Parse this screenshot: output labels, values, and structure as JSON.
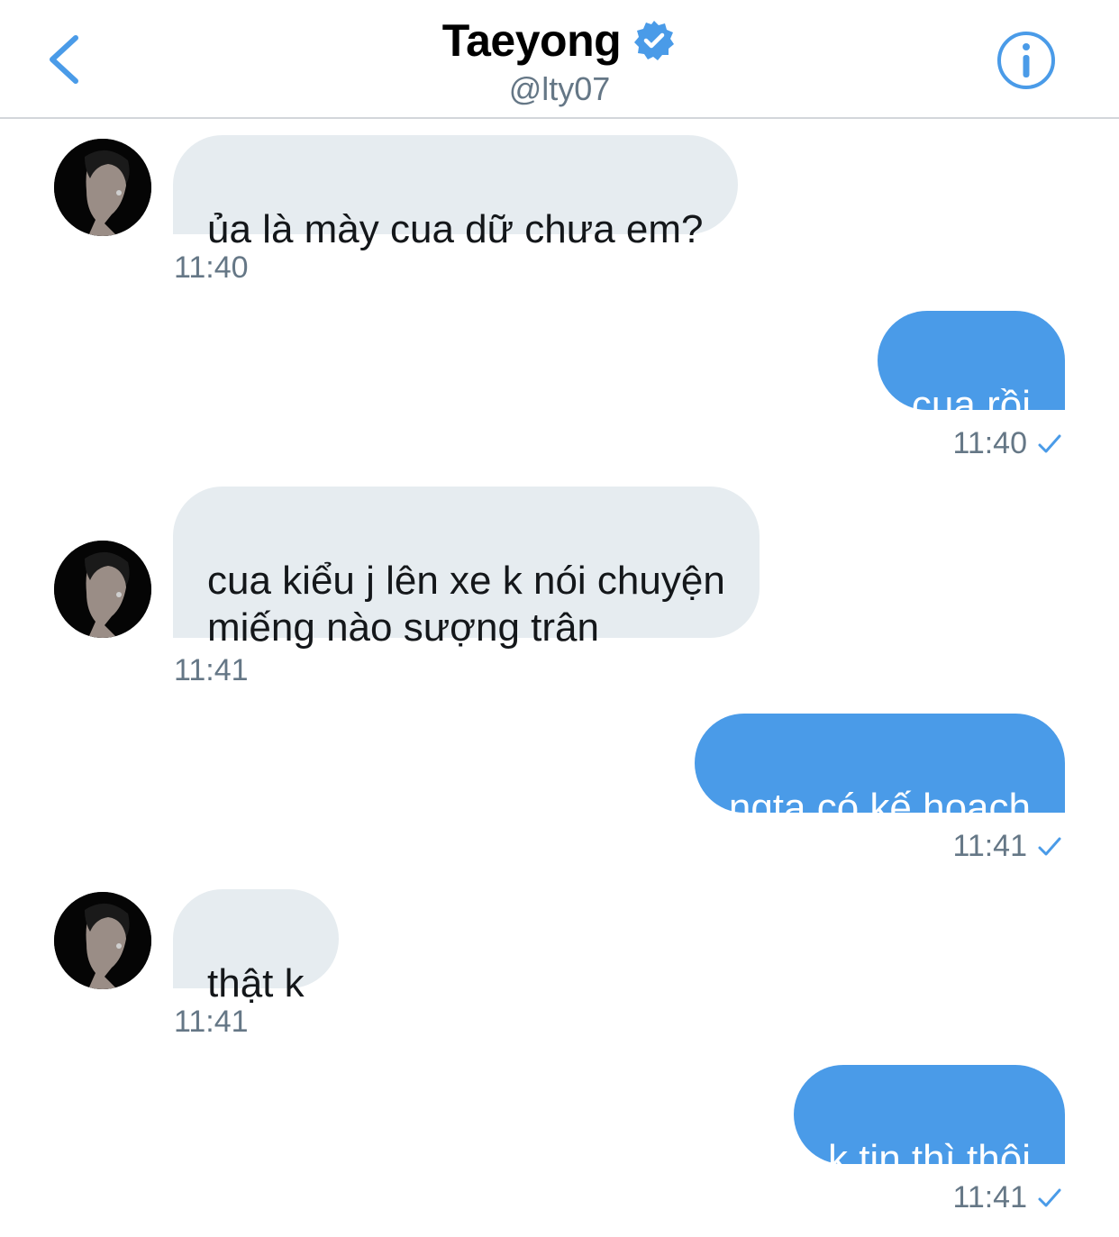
{
  "header": {
    "title": "Taeyong",
    "handle": "@lty07",
    "back_icon": "chevron-left-icon",
    "info_icon": "info-icon",
    "verified_icon": "verified-badge-icon",
    "accent_color": "#4a9be8"
  },
  "messages": [
    {
      "direction": "incoming",
      "text": "ủa là mày cua dữ chưa em?",
      "time": "11:40"
    },
    {
      "direction": "outgoing",
      "text": "cua rồi",
      "time": "11:40",
      "status_icon": "check-icon"
    },
    {
      "direction": "incoming",
      "text": "cua kiểu j lên xe k nói chuyện\nmiếng nào sượng trân",
      "time": "11:41"
    },
    {
      "direction": "outgoing",
      "text": "ngta có kế hoạch",
      "time": "11:41",
      "status_icon": "check-icon"
    },
    {
      "direction": "incoming",
      "text": "thật k",
      "time": "11:41"
    },
    {
      "direction": "outgoing",
      "text": "k tin thì thôi",
      "time": "11:41",
      "status_icon": "check-icon"
    }
  ]
}
